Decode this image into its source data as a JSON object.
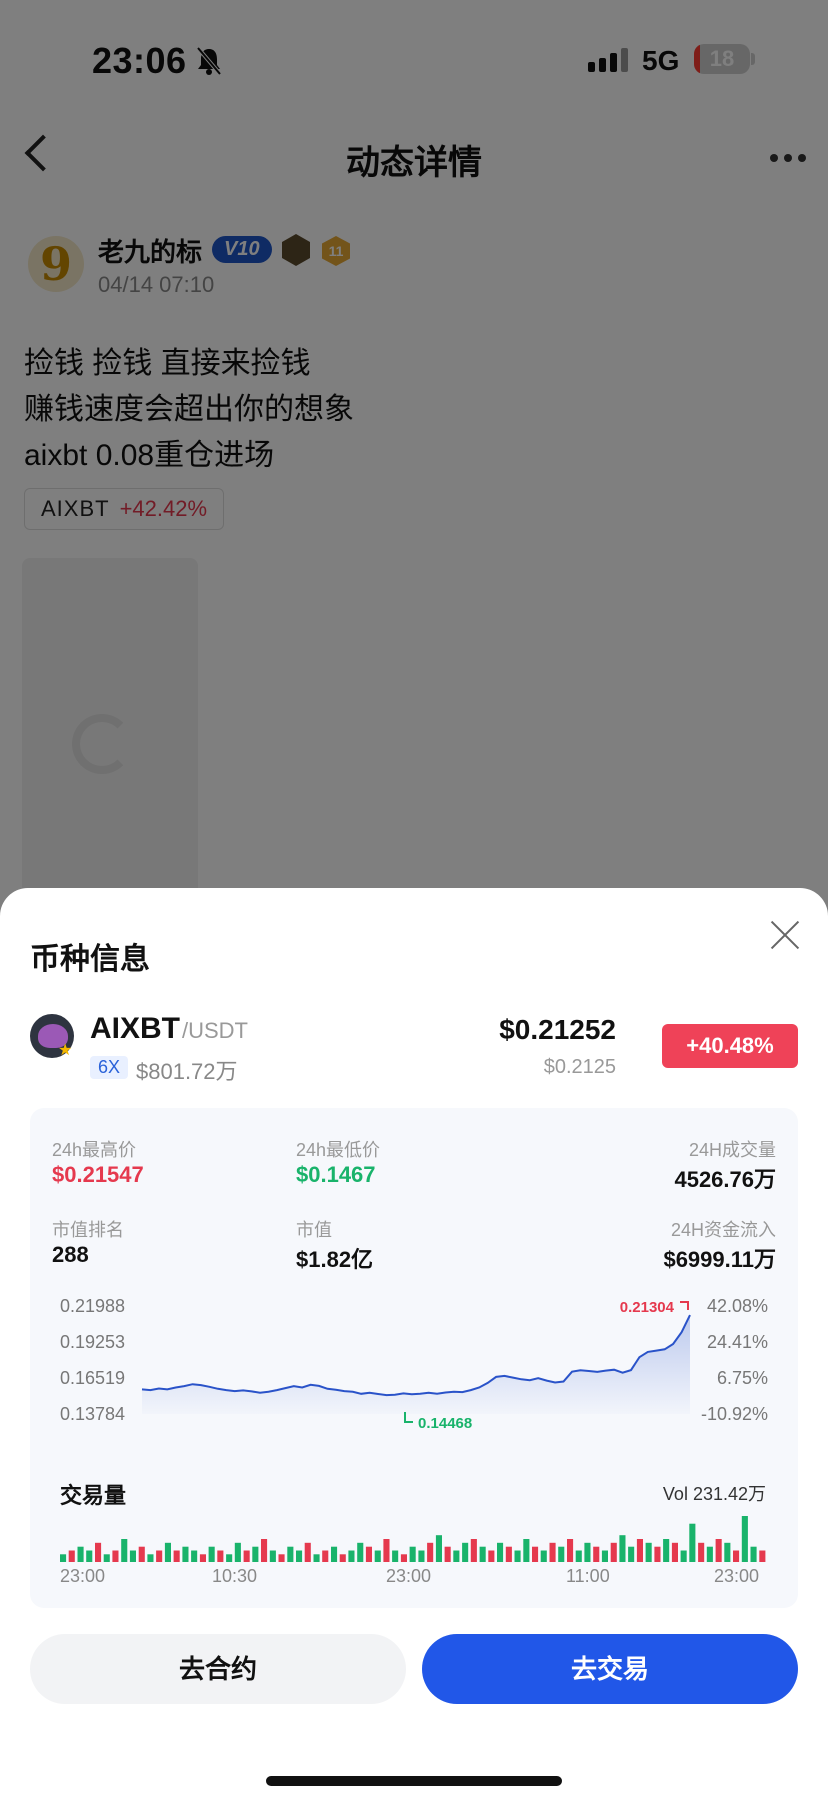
{
  "status_bar": {
    "time": "23:06",
    "network": "5G",
    "battery": "18",
    "signal_bars": 4,
    "battery_level": 18
  },
  "header": {
    "title": "动态详情"
  },
  "post": {
    "avatar_text": "9",
    "username": "老九的标",
    "vip": "V10",
    "badge_level": "11",
    "time": "04/14 07:10",
    "lines": [
      "捡钱 捡钱 直接来捡钱",
      "赚钱速度会超出你的想象",
      "aixbt 0.08重仓进场"
    ],
    "tag": {
      "symbol": "AIXBT",
      "change": "+42.42%"
    }
  },
  "sheet": {
    "title": "币种信息",
    "coin": {
      "name": "AIXBT",
      "quote": "/USDT",
      "leverage": "6X",
      "small_value": "$801.72万",
      "price": "$0.21252",
      "price_sub": "$0.2125",
      "change": "+40.48%"
    },
    "stats": {
      "high_label": "24h最高价",
      "high": "$0.21547",
      "low_label": "24h最低价",
      "low": "$0.1467",
      "volume_label": "24H成交量",
      "volume": "4526.76万",
      "rank_label": "市值排名",
      "rank": "288",
      "mcap_label": "市值",
      "mcap": "$1.82亿",
      "flow_label": "24H资金流入",
      "flow": "$6999.11万"
    },
    "volume_title": "交易量",
    "volume_total": "Vol 231.42万",
    "time_labels": [
      "23:00",
      "10:30",
      "23:00",
      "11:00",
      "23:00"
    ],
    "buttons": {
      "contract": "去合约",
      "trade": "去交易"
    }
  },
  "colors": {
    "up": "#e5394e",
    "down": "#19b36b",
    "primary": "#2157e8",
    "line": "#2a53c9"
  },
  "chart_data": {
    "type": "line",
    "y_ticks": [
      "0.21988",
      "0.19253",
      "0.16519",
      "0.13784"
    ],
    "pct_ticks": [
      "42.08%",
      "24.41%",
      "6.75%",
      "-10.92%"
    ],
    "ylim": [
      0.13784,
      0.21988
    ],
    "high_label": "0.21304",
    "low_label": "0.14468",
    "series": [
      {
        "values": [
          0.1565,
          0.156,
          0.1572,
          0.1565,
          0.158,
          0.159,
          0.1605,
          0.1598,
          0.1585,
          0.157,
          0.156,
          0.1552,
          0.1558,
          0.155,
          0.154,
          0.1548,
          0.156,
          0.1575,
          0.159,
          0.158,
          0.16,
          0.1592,
          0.157,
          0.1562,
          0.1552,
          0.1547,
          0.1532,
          0.154,
          0.153,
          0.1522,
          0.1525,
          0.1535,
          0.1528,
          0.1532,
          0.154,
          0.1532,
          0.1542,
          0.1548,
          0.1545,
          0.156,
          0.158,
          0.1615,
          0.166,
          0.1668,
          0.1655,
          0.1642,
          0.1635,
          0.165,
          0.1632,
          0.1618,
          0.1625,
          0.17,
          0.171,
          0.1705,
          0.1698,
          0.1708,
          0.1715,
          0.1692,
          0.1712,
          0.181,
          0.185,
          0.186,
          0.187,
          0.191,
          0.2,
          0.213
        ]
      }
    ],
    "volume": {
      "values": [
        0.2,
        0.3,
        0.4,
        0.3,
        0.5,
        0.2,
        0.3,
        0.6,
        0.3,
        0.4,
        0.2,
        0.3,
        0.5,
        0.3,
        0.4,
        0.3,
        0.2,
        0.4,
        0.3,
        0.2,
        0.5,
        0.3,
        0.4,
        0.6,
        0.3,
        0.2,
        0.4,
        0.3,
        0.5,
        0.2,
        0.3,
        0.4,
        0.2,
        0.3,
        0.5,
        0.4,
        0.3,
        0.6,
        0.3,
        0.2,
        0.4,
        0.3,
        0.5,
        0.7,
        0.4,
        0.3,
        0.5,
        0.6,
        0.4,
        0.3,
        0.5,
        0.4,
        0.3,
        0.6,
        0.4,
        0.3,
        0.5,
        0.4,
        0.6,
        0.3,
        0.5,
        0.4,
        0.3,
        0.5,
        0.7,
        0.4,
        0.6,
        0.5,
        0.4,
        0.6,
        0.5,
        0.3,
        1.0,
        0.5,
        0.4,
        0.6,
        0.5,
        0.3,
        1.2,
        0.4,
        0.3
      ],
      "up": [
        true,
        false,
        true,
        true,
        false,
        true,
        false,
        true,
        true,
        false,
        true,
        false,
        true,
        false,
        true,
        true,
        false,
        true,
        false,
        true,
        true,
        false,
        true,
        false,
        true,
        false,
        true,
        true,
        false,
        true,
        false,
        true,
        false,
        true,
        true,
        false,
        true,
        false,
        true,
        false,
        true,
        true,
        false,
        true,
        false,
        true,
        true,
        false,
        true,
        false,
        true,
        false,
        true,
        true,
        false,
        true,
        false,
        true,
        false,
        true,
        true,
        false,
        true,
        false,
        true,
        true,
        false,
        true,
        false,
        true,
        false,
        true,
        true,
        false,
        true,
        false,
        true,
        false,
        true,
        true,
        false
      ]
    }
  }
}
